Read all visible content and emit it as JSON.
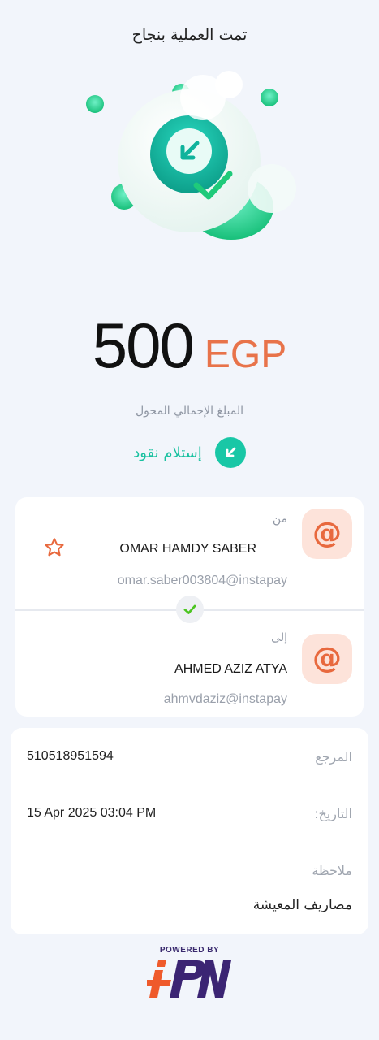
{
  "header": {
    "title": "تمت العملية بنجاح"
  },
  "transaction": {
    "amount": "500",
    "currency": "EGP",
    "total_label": "المبلغ الإجمالي المحول",
    "type_label": "إستلام نقود",
    "type_icon": "arrow-down-left-icon"
  },
  "from": {
    "label": "من",
    "name": "OMAR HAMDY SABER",
    "handle": "omar.saber003804@instapay",
    "icon": "at-sign-icon",
    "favorite_icon": "star-outline-icon"
  },
  "to": {
    "label": "إلى",
    "name": "AHMED AZIZ ATYA",
    "handle": "ahmvdaziz@instapay",
    "icon": "at-sign-icon"
  },
  "details": {
    "reference_label": "المرجع",
    "reference_value": "510518951594",
    "date_label": "التاريخ:",
    "date_value": "15 Apr 2025 03:04 PM",
    "note_label": "ملاحظة",
    "note_value": "مصاريف المعيشة"
  },
  "footer": {
    "powered_by": "POWERED BY",
    "logo_name": "IPN"
  },
  "colors": {
    "accent_green": "#19c7a6",
    "accent_orange": "#e8734a",
    "badge_bg": "#fde3da",
    "background": "#f2f5fb"
  }
}
